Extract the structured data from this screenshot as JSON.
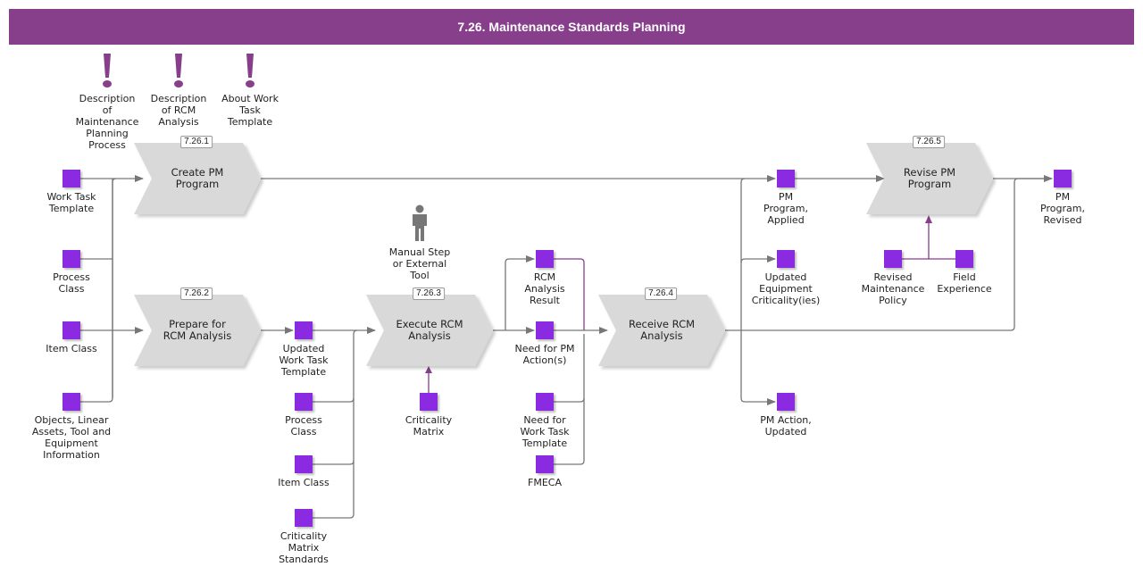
{
  "title": "7.26. Maintenance Standards Planning",
  "colors": {
    "header": "#873f8c",
    "object": "#8a2be2",
    "process": "#d9d9da",
    "connector": "#777777",
    "info": "#873f8c"
  },
  "info_items": [
    {
      "label": "Description\nof\nMaintenance\nPlanning\nProcess",
      "icon": "exclamation-icon"
    },
    {
      "label": "Description\nof RCM\nAnalysis",
      "icon": "exclamation-icon"
    },
    {
      "label": "About Work\nTask\nTemplate",
      "icon": "exclamation-icon"
    }
  ],
  "processes": [
    {
      "id": "7.26.1",
      "label": "Create PM\nProgram"
    },
    {
      "id": "7.26.2",
      "label": "Prepare for\nRCM Analysis"
    },
    {
      "id": "7.26.3",
      "label": "Execute RCM\nAnalysis"
    },
    {
      "id": "7.26.4",
      "label": "Receive RCM\nAnalysis"
    },
    {
      "id": "7.26.5",
      "label": "Revise PM\nProgram"
    }
  ],
  "manual_step": {
    "label": "Manual Step\nor External\nTool",
    "icon": "person-icon"
  },
  "objects": [
    {
      "label": "Work Task\nTemplate"
    },
    {
      "label": "Process\nClass"
    },
    {
      "label": "Item Class"
    },
    {
      "label": "Objects, Linear\nAssets, Tool and\nEquipment\nInformation"
    },
    {
      "label": "Updated\nWork Task\nTemplate"
    },
    {
      "label": "Process\nClass"
    },
    {
      "label": "Item Class"
    },
    {
      "label": "Criticality\nMatrix\nStandards"
    },
    {
      "label": "Criticality\nMatrix"
    },
    {
      "label": "RCM\nAnalysis\nResult"
    },
    {
      "label": "Need for PM\nAction(s)"
    },
    {
      "label": "Need for\nWork Task\nTemplate"
    },
    {
      "label": "FMECA"
    },
    {
      "label": "PM\nProgram,\nApplied"
    },
    {
      "label": "Updated\nEquipment\nCriticality(ies)"
    },
    {
      "label": "PM Action,\nUpdated"
    },
    {
      "label": "Revised\nMaintenance\nPolicy"
    },
    {
      "label": "Field\nExperience"
    },
    {
      "label": "PM\nProgram,\nRevised"
    }
  ]
}
